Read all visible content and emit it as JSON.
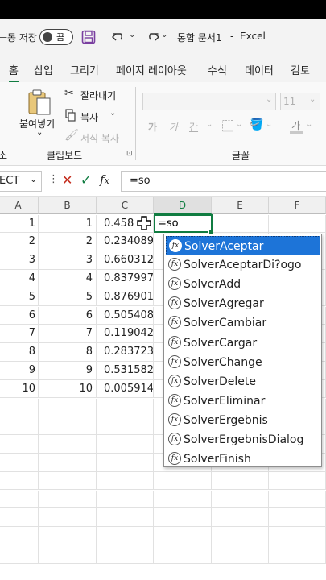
{
  "titlebar": {
    "autosave_label": "ᅳ동 저장",
    "toggle_state": "끔",
    "doc_name": "통합 문서1",
    "separator": "-",
    "app_name": "Excel"
  },
  "tabs": [
    "홈",
    "삽입",
    "그리기",
    "페이지 레이아웃",
    "수식",
    "데이터",
    "검토"
  ],
  "ribbon": {
    "paste_label": "붙여넣기",
    "cut_label": "잘라내기",
    "copy_label": "복사",
    "format_painter_label": "서식 복사",
    "clipboard_group": "클립보드",
    "font_group": "글꼴",
    "font_size": "11",
    "left_group_tail": "소",
    "bold_glyph": "가",
    "italic_glyph": "가",
    "underline_glyph": "간",
    "font_color_glyph": "가",
    "grow_glyph": "가"
  },
  "formula_bar": {
    "name_box": "ECT",
    "formula": "=so"
  },
  "columns": [
    "A",
    "B",
    "C",
    "D",
    "E",
    "F"
  ],
  "rows": [
    {
      "a": "1",
      "b": "1",
      "c": "0.458"
    },
    {
      "a": "2",
      "b": "2",
      "c": "0.234089"
    },
    {
      "a": "3",
      "b": "3",
      "c": "0.660312"
    },
    {
      "a": "4",
      "b": "4",
      "c": "0.837997"
    },
    {
      "a": "5",
      "b": "5",
      "c": "0.876901"
    },
    {
      "a": "6",
      "b": "6",
      "c": "0.505408"
    },
    {
      "a": "7",
      "b": "7",
      "c": "0.119042"
    },
    {
      "a": "8",
      "b": "8",
      "c": "0.283723"
    },
    {
      "a": "9",
      "b": "9",
      "c": "0.531582"
    },
    {
      "a": "10",
      "b": "10",
      "c": "0.005914"
    }
  ],
  "active_cell_text": "=so",
  "autocomplete": {
    "fx_glyph": "fx",
    "items": [
      "SolverAceptar",
      "SolverAceptarDi?ogo",
      "SolverAdd",
      "SolverAgregar",
      "SolverCambiar",
      "SolverCargar",
      "SolverChange",
      "SolverDelete",
      "SolverEliminar",
      "SolverErgebnis",
      "SolverErgebnisDialog",
      "SolverFinish"
    ]
  },
  "colors": {
    "excel_green": "#107c41",
    "selection_blue": "#1d74d8",
    "save_icon_purple": "#7a3fa0",
    "cancel_red": "#c42b1c"
  }
}
